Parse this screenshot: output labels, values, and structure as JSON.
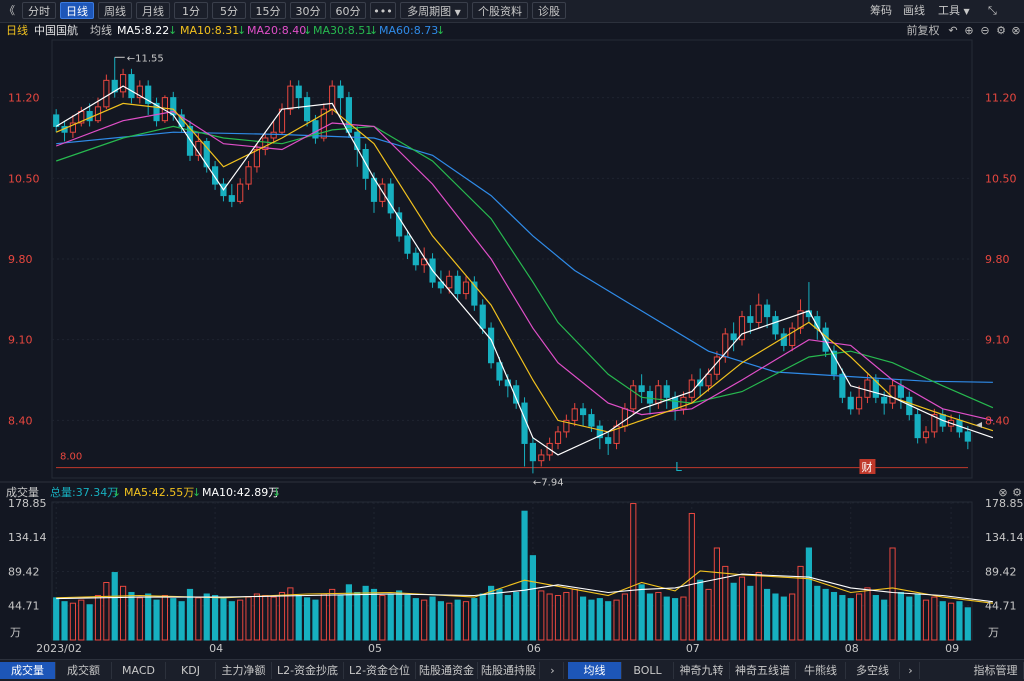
{
  "toolbar": {
    "collapse": "《",
    "periods": [
      "分时",
      "日线",
      "周线",
      "月线",
      "1分",
      "5分",
      "15分",
      "30分",
      "60分"
    ],
    "active_period": "日线",
    "more": "•••",
    "multi_period": "多周期图",
    "stock_info": "个股资料",
    "diagnose": "诊股",
    "right_chips": "筹码",
    "right_draw": "画线",
    "right_tools": "工具",
    "expand": "⤡"
  },
  "ma_header": {
    "period": "日线",
    "stock_name": "中国国航",
    "indicator": "均线",
    "ma5": "MA5:8.22",
    "ma10": "MA10:8.31",
    "ma20": "MA20:8.40",
    "ma30": "MA30:8.51",
    "ma60": "MA60:8.73",
    "adjust": "前复权"
  },
  "colors": {
    "background": "#131722",
    "up": "#e8473f",
    "down": "#17b0c0",
    "ma5": "#ffffff",
    "ma10": "#f2c21e",
    "ma20": "#e04fc8",
    "ma30": "#27b94f",
    "ma60": "#2f8be8",
    "axis_text": "#e8473f",
    "support_line": "#c0392b"
  },
  "price_axis": {
    "ticks": [
      "11.20",
      "10.50",
      "9.80",
      "9.10",
      "8.40"
    ],
    "support_label": "8.00",
    "high_label": "11.55",
    "low_label": "7.94",
    "marker_L": "L",
    "marker_cai": "财"
  },
  "volume_header": {
    "title": "成交量",
    "total": "总量:37.34万",
    "ma5": "MA5:42.55万",
    "ma10": "MA10:42.89万"
  },
  "volume_axis": {
    "ticks": [
      "178.85",
      "134.14",
      "89.42",
      "44.71"
    ],
    "unit": "万"
  },
  "date_axis": [
    "2023/02",
    "04",
    "05",
    "06",
    "07",
    "08",
    "09"
  ],
  "bottom_tabs": [
    "成交量",
    "成交额",
    "MACD",
    "KDJ",
    "主力净额",
    "L2-资金抄底",
    "L2-资金仓位",
    "陆股通资金",
    "陆股通持股",
    "均线",
    "BOLL",
    "神奇九转",
    "神奇五线谱",
    "牛熊线",
    "多空线",
    "指标管理"
  ],
  "active_bottom_tab": "成交量",
  "chart_data": {
    "type": "candlestick",
    "ylim": [
      7.9,
      11.7
    ],
    "volume_ylim": [
      0,
      180
    ],
    "candles": [
      [
        11.05,
        10.95,
        11.1,
        10.9,
        55
      ],
      [
        10.95,
        10.9,
        11.0,
        10.82,
        50
      ],
      [
        10.9,
        10.98,
        11.05,
        10.85,
        48
      ],
      [
        10.98,
        11.08,
        11.12,
        10.95,
        52
      ],
      [
        11.08,
        11.0,
        11.15,
        10.95,
        46
      ],
      [
        11.0,
        11.12,
        11.2,
        10.98,
        58
      ],
      [
        11.12,
        11.35,
        11.4,
        11.1,
        75
      ],
      [
        11.35,
        11.25,
        11.55,
        11.2,
        88
      ],
      [
        11.25,
        11.4,
        11.45,
        11.2,
        70
      ],
      [
        11.4,
        11.2,
        11.45,
        11.15,
        62
      ],
      [
        11.2,
        11.3,
        11.35,
        11.15,
        55
      ],
      [
        11.3,
        11.15,
        11.35,
        11.05,
        60
      ],
      [
        11.15,
        11.0,
        11.2,
        10.95,
        52
      ],
      [
        11.0,
        11.2,
        11.22,
        10.98,
        58
      ],
      [
        11.2,
        11.05,
        11.25,
        11.0,
        54
      ],
      [
        11.05,
        10.95,
        11.1,
        10.9,
        50
      ],
      [
        10.95,
        10.7,
        11.0,
        10.65,
        66
      ],
      [
        10.7,
        10.82,
        10.9,
        10.65,
        55
      ],
      [
        10.82,
        10.6,
        10.85,
        10.55,
        60
      ],
      [
        10.6,
        10.45,
        10.65,
        10.4,
        58
      ],
      [
        10.45,
        10.35,
        10.5,
        10.3,
        54
      ],
      [
        10.35,
        10.3,
        10.45,
        10.25,
        50
      ],
      [
        10.3,
        10.45,
        10.5,
        10.28,
        52
      ],
      [
        10.45,
        10.6,
        10.65,
        10.4,
        56
      ],
      [
        10.6,
        10.75,
        10.8,
        10.55,
        60
      ],
      [
        10.75,
        10.85,
        10.9,
        10.7,
        58
      ],
      [
        10.85,
        10.9,
        11.0,
        10.8,
        56
      ],
      [
        10.9,
        11.1,
        11.15,
        10.88,
        62
      ],
      [
        11.1,
        11.3,
        11.35,
        11.05,
        68
      ],
      [
        11.3,
        11.2,
        11.35,
        11.1,
        58
      ],
      [
        11.2,
        11.0,
        11.25,
        10.95,
        55
      ],
      [
        11.0,
        10.85,
        11.05,
        10.8,
        52
      ],
      [
        10.85,
        11.1,
        11.15,
        10.82,
        60
      ],
      [
        11.1,
        11.3,
        11.35,
        11.05,
        66
      ],
      [
        11.3,
        11.2,
        11.35,
        11.05,
        58
      ],
      [
        11.2,
        10.9,
        11.25,
        10.85,
        72
      ],
      [
        10.9,
        10.75,
        10.95,
        10.6,
        62
      ],
      [
        10.75,
        10.5,
        10.8,
        10.4,
        70
      ],
      [
        10.5,
        10.3,
        10.55,
        10.2,
        66
      ],
      [
        10.3,
        10.45,
        10.5,
        10.25,
        58
      ],
      [
        10.45,
        10.2,
        10.5,
        10.15,
        60
      ],
      [
        10.2,
        10.0,
        10.25,
        9.95,
        64
      ],
      [
        10.0,
        9.85,
        10.05,
        9.8,
        58
      ],
      [
        9.85,
        9.75,
        9.9,
        9.7,
        54
      ],
      [
        9.75,
        9.8,
        9.9,
        9.68,
        52
      ],
      [
        9.8,
        9.6,
        9.85,
        9.55,
        56
      ],
      [
        9.6,
        9.55,
        9.7,
        9.5,
        50
      ],
      [
        9.55,
        9.65,
        9.7,
        9.5,
        48
      ],
      [
        9.65,
        9.5,
        9.7,
        9.45,
        52
      ],
      [
        9.5,
        9.6,
        9.65,
        9.45,
        50
      ],
      [
        9.6,
        9.4,
        9.65,
        9.35,
        54
      ],
      [
        9.4,
        9.2,
        9.45,
        9.15,
        60
      ],
      [
        9.2,
        8.9,
        9.25,
        8.85,
        70
      ],
      [
        8.9,
        8.75,
        8.95,
        8.7,
        66
      ],
      [
        8.75,
        8.7,
        8.8,
        8.6,
        58
      ],
      [
        8.7,
        8.55,
        8.75,
        8.5,
        62
      ],
      [
        8.55,
        8.2,
        8.6,
        8.0,
        168
      ],
      [
        8.2,
        8.05,
        8.25,
        7.94,
        110
      ],
      [
        8.05,
        8.1,
        8.15,
        8.0,
        64
      ],
      [
        8.1,
        8.2,
        8.25,
        8.05,
        60
      ],
      [
        8.2,
        8.3,
        8.35,
        8.15,
        58
      ],
      [
        8.3,
        8.4,
        8.45,
        8.25,
        62
      ],
      [
        8.4,
        8.5,
        8.55,
        8.35,
        66
      ],
      [
        8.5,
        8.45,
        8.55,
        8.35,
        56
      ],
      [
        8.45,
        8.35,
        8.5,
        8.3,
        52
      ],
      [
        8.35,
        8.25,
        8.4,
        8.15,
        54
      ],
      [
        8.25,
        8.2,
        8.3,
        8.1,
        50
      ],
      [
        8.2,
        8.35,
        8.4,
        8.15,
        52
      ],
      [
        8.35,
        8.5,
        8.55,
        8.3,
        60
      ],
      [
        8.5,
        8.7,
        8.75,
        8.45,
        178
      ],
      [
        8.7,
        8.65,
        8.8,
        8.55,
        72
      ],
      [
        8.65,
        8.55,
        8.7,
        8.45,
        60
      ],
      [
        8.55,
        8.7,
        8.75,
        8.5,
        62
      ],
      [
        8.7,
        8.6,
        8.75,
        8.5,
        56
      ],
      [
        8.6,
        8.5,
        8.65,
        8.4,
        54
      ],
      [
        8.5,
        8.6,
        8.65,
        8.45,
        56
      ],
      [
        8.6,
        8.75,
        8.8,
        8.55,
        165
      ],
      [
        8.75,
        8.7,
        8.85,
        8.6,
        78
      ],
      [
        8.7,
        8.8,
        8.85,
        8.65,
        66
      ],
      [
        8.8,
        8.95,
        9.0,
        8.75,
        120
      ],
      [
        8.95,
        9.15,
        9.2,
        8.9,
        96
      ],
      [
        9.15,
        9.1,
        9.25,
        9.0,
        74
      ],
      [
        9.1,
        9.3,
        9.35,
        9.05,
        82
      ],
      [
        9.3,
        9.25,
        9.4,
        9.15,
        70
      ],
      [
        9.25,
        9.4,
        9.5,
        9.2,
        88
      ],
      [
        9.4,
        9.3,
        9.45,
        9.2,
        66
      ],
      [
        9.3,
        9.15,
        9.35,
        9.1,
        60
      ],
      [
        9.15,
        9.05,
        9.2,
        9.0,
        56
      ],
      [
        9.05,
        9.2,
        9.25,
        9.0,
        60
      ],
      [
        9.2,
        9.35,
        9.45,
        9.15,
        96
      ],
      [
        9.35,
        9.3,
        9.6,
        9.25,
        120
      ],
      [
        9.3,
        9.2,
        9.35,
        9.1,
        70
      ],
      [
        9.2,
        9.0,
        9.25,
        8.95,
        66
      ],
      [
        9.0,
        8.8,
        9.05,
        8.75,
        62
      ],
      [
        8.8,
        8.6,
        8.85,
        8.55,
        58
      ],
      [
        8.6,
        8.5,
        8.65,
        8.45,
        54
      ],
      [
        8.5,
        8.6,
        8.7,
        8.45,
        60
      ],
      [
        8.6,
        8.75,
        8.8,
        8.55,
        68
      ],
      [
        8.75,
        8.6,
        8.8,
        8.55,
        58
      ],
      [
        8.6,
        8.55,
        8.65,
        8.45,
        52
      ],
      [
        8.55,
        8.7,
        8.75,
        8.5,
        120
      ],
      [
        8.7,
        8.6,
        8.75,
        8.5,
        62
      ],
      [
        8.6,
        8.45,
        8.65,
        8.4,
        56
      ],
      [
        8.45,
        8.25,
        8.5,
        8.2,
        60
      ],
      [
        8.25,
        8.3,
        8.35,
        8.2,
        52
      ],
      [
        8.3,
        8.45,
        8.5,
        8.25,
        56
      ],
      [
        8.45,
        8.35,
        8.5,
        8.3,
        50
      ],
      [
        8.35,
        8.4,
        8.45,
        8.3,
        48
      ],
      [
        8.4,
        8.3,
        8.45,
        8.25,
        50
      ],
      [
        8.3,
        8.22,
        8.35,
        8.15,
        42
      ]
    ],
    "ma_series": {
      "ma5": [
        [
          0,
          10.95
        ],
        [
          8,
          11.3
        ],
        [
          14,
          11.05
        ],
        [
          20,
          10.4
        ],
        [
          27,
          11.1
        ],
        [
          33,
          11.15
        ],
        [
          38,
          10.5
        ],
        [
          45,
          9.7
        ],
        [
          52,
          9.1
        ],
        [
          57,
          8.25
        ],
        [
          60,
          8.1
        ],
        [
          66,
          8.3
        ],
        [
          70,
          8.5
        ],
        [
          76,
          8.65
        ],
        [
          82,
          9.15
        ],
        [
          90,
          9.35
        ],
        [
          95,
          8.7
        ],
        [
          100,
          8.6
        ],
        [
          106,
          8.4
        ],
        [
          112,
          8.25
        ]
      ],
      "ma10": [
        [
          0,
          10.9
        ],
        [
          8,
          11.15
        ],
        [
          14,
          11.1
        ],
        [
          20,
          10.6
        ],
        [
          27,
          10.85
        ],
        [
          33,
          11.1
        ],
        [
          38,
          10.8
        ],
        [
          45,
          10.0
        ],
        [
          52,
          9.4
        ],
        [
          57,
          8.75
        ],
        [
          60,
          8.4
        ],
        [
          66,
          8.3
        ],
        [
          70,
          8.4
        ],
        [
          76,
          8.55
        ],
        [
          82,
          8.9
        ],
        [
          90,
          9.25
        ],
        [
          95,
          8.95
        ],
        [
          100,
          8.6
        ],
        [
          106,
          8.45
        ],
        [
          112,
          8.31
        ]
      ],
      "ma20": [
        [
          0,
          10.78
        ],
        [
          8,
          11.0
        ],
        [
          14,
          11.08
        ],
        [
          20,
          10.8
        ],
        [
          27,
          10.75
        ],
        [
          33,
          10.98
        ],
        [
          38,
          10.95
        ],
        [
          45,
          10.45
        ],
        [
          52,
          9.8
        ],
        [
          57,
          9.2
        ],
        [
          60,
          8.9
        ],
        [
          66,
          8.55
        ],
        [
          70,
          8.45
        ],
        [
          76,
          8.5
        ],
        [
          82,
          8.75
        ],
        [
          90,
          9.1
        ],
        [
          95,
          9.05
        ],
        [
          100,
          8.75
        ],
        [
          106,
          8.5
        ],
        [
          112,
          8.4
        ]
      ],
      "ma30": [
        [
          0,
          10.65
        ],
        [
          8,
          10.85
        ],
        [
          14,
          10.95
        ],
        [
          20,
          10.85
        ],
        [
          27,
          10.8
        ],
        [
          33,
          10.92
        ],
        [
          38,
          10.95
        ],
        [
          45,
          10.65
        ],
        [
          52,
          10.15
        ],
        [
          57,
          9.6
        ],
        [
          60,
          9.25
        ],
        [
          66,
          8.8
        ],
        [
          70,
          8.6
        ],
        [
          76,
          8.55
        ],
        [
          82,
          8.65
        ],
        [
          90,
          8.95
        ],
        [
          95,
          9.0
        ],
        [
          100,
          8.9
        ],
        [
          106,
          8.7
        ],
        [
          112,
          8.51
        ]
      ],
      "ma60": [
        [
          0,
          10.8
        ],
        [
          14,
          10.9
        ],
        [
          27,
          10.88
        ],
        [
          38,
          10.85
        ],
        [
          45,
          10.7
        ],
        [
          52,
          10.35
        ],
        [
          57,
          10.0
        ],
        [
          62,
          9.7
        ],
        [
          70,
          9.35
        ],
        [
          78,
          9.0
        ],
        [
          86,
          8.82
        ],
        [
          95,
          8.78
        ],
        [
          104,
          8.74
        ],
        [
          112,
          8.73
        ]
      ]
    },
    "vol_ma5": [
      [
        0,
        55
      ],
      [
        10,
        58
      ],
      [
        20,
        55
      ],
      [
        30,
        60
      ],
      [
        40,
        62
      ],
      [
        50,
        56
      ],
      [
        56,
        78
      ],
      [
        60,
        70
      ],
      [
        66,
        58
      ],
      [
        70,
        75
      ],
      [
        74,
        64
      ],
      [
        77,
        90
      ],
      [
        82,
        85
      ],
      [
        90,
        80
      ],
      [
        95,
        62
      ],
      [
        100,
        68
      ],
      [
        106,
        56
      ],
      [
        112,
        48
      ]
    ],
    "vol_ma10": [
      [
        0,
        54
      ],
      [
        10,
        56
      ],
      [
        20,
        56
      ],
      [
        30,
        58
      ],
      [
        40,
        60
      ],
      [
        50,
        58
      ],
      [
        56,
        65
      ],
      [
        60,
        72
      ],
      [
        66,
        62
      ],
      [
        70,
        66
      ],
      [
        74,
        68
      ],
      [
        77,
        75
      ],
      [
        82,
        86
      ],
      [
        90,
        82
      ],
      [
        95,
        68
      ],
      [
        100,
        62
      ],
      [
        106,
        58
      ],
      [
        112,
        50
      ]
    ]
  }
}
